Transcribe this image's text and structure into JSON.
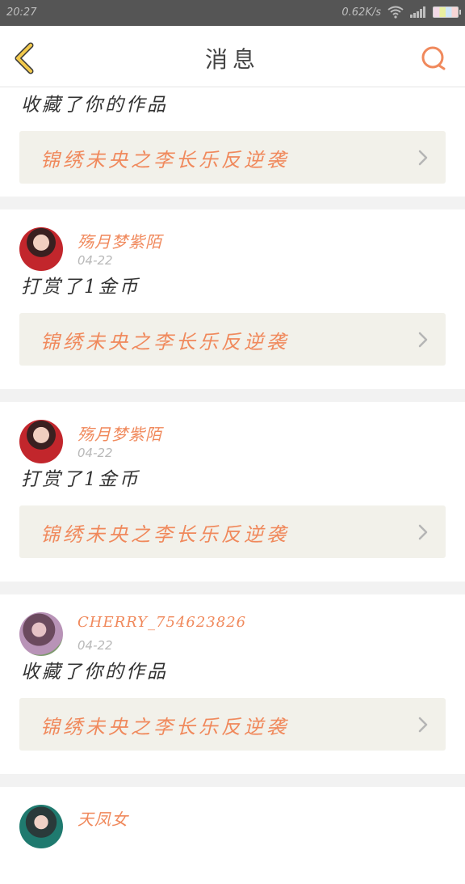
{
  "status_bar": {
    "time": "20:27",
    "net_speed": "0.62K/s"
  },
  "header": {
    "title": "消息",
    "back_icon": "chevron-left-icon",
    "search_icon": "search-icon"
  },
  "colors": {
    "accent": "#f0895c",
    "work_bg": "#f2f1ea",
    "back_icon": "#f2c94c"
  },
  "messages": [
    {
      "action": "收藏了你的作品",
      "work_title": "锦绣未央之李长乐反逆袭"
    },
    {
      "user": "殇月梦紫陌",
      "date": "04-22",
      "action": "打赏了1金币",
      "work_title": "锦绣未央之李长乐反逆袭"
    },
    {
      "user": "殇月梦紫陌",
      "date": "04-22",
      "action": "打赏了1金币",
      "work_title": "锦绣未央之李长乐反逆袭"
    },
    {
      "user": "CHERRY_754623826",
      "date": "04-22",
      "action": "收藏了你的作品",
      "work_title": "锦绣未央之李长乐反逆袭"
    },
    {
      "user": "天凤女"
    }
  ]
}
